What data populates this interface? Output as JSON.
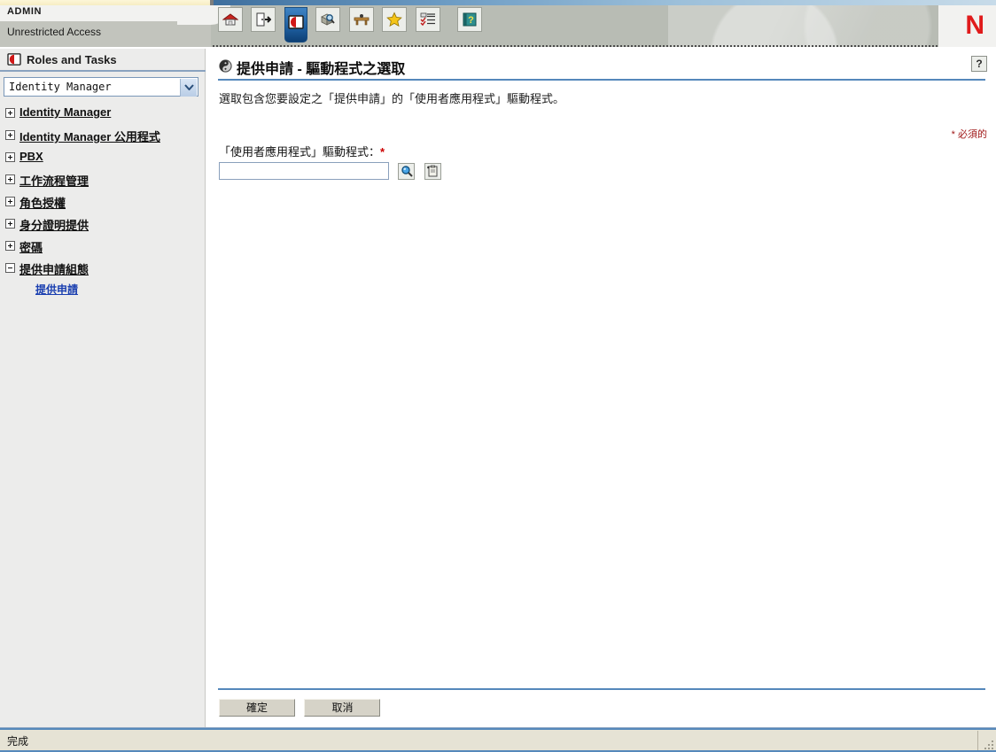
{
  "header": {
    "admin_label": "ADMIN",
    "access_label": "Unrestricted Access",
    "brand_logo": "N",
    "brand_color": "#e01b1b"
  },
  "toolbar": {
    "items": [
      {
        "name": "home-icon",
        "title": "Home"
      },
      {
        "name": "logout-icon",
        "title": "Exit"
      },
      {
        "name": "roles-and-tasks-icon",
        "title": "Roles and Tasks",
        "selected": true
      },
      {
        "name": "object-search-icon",
        "title": "View Objects"
      },
      {
        "name": "workbench-icon",
        "title": "Configure"
      },
      {
        "name": "favorites-star-icon",
        "title": "Favorites"
      },
      {
        "name": "task-list-icon",
        "title": "Task List"
      },
      {
        "name": "help-book-icon",
        "title": "Help"
      }
    ]
  },
  "sidebar": {
    "panel_title": "Roles and Tasks",
    "panel_icon": "roles-and-tasks-icon",
    "view_select": {
      "value": "Identity Manager",
      "options": [
        "Identity Manager"
      ]
    },
    "items": [
      {
        "label": "Identity Manager",
        "expanded": false
      },
      {
        "label": "Identity Manager 公用程式",
        "expanded": false
      },
      {
        "label": "PBX",
        "expanded": false
      },
      {
        "label": "工作流程管理",
        "expanded": false
      },
      {
        "label": "角色授權",
        "expanded": false
      },
      {
        "label": "身分證明提供",
        "expanded": false
      },
      {
        "label": "密碼",
        "expanded": false
      },
      {
        "label": "提供申請組態",
        "expanded": true,
        "children": [
          {
            "label": "提供申請",
            "selected": true
          }
        ]
      }
    ]
  },
  "content": {
    "help_button": "?",
    "title": "提供申請 - 驅動程式之選取",
    "title_icon": "provisioning-request-icon",
    "description": "選取包含您要設定之「提供申請」的「使用者應用程式」驅動程式。",
    "required_note": "* 必須的",
    "field": {
      "label": "「使用者應用程式」驅動程式：",
      "required_mark": "*",
      "value": "",
      "placeholder": "",
      "search_icon": "magnifier-icon",
      "object_selector_icon": "object-selector-icon"
    },
    "buttons": [
      {
        "label": "確定",
        "name": "ok-button"
      },
      {
        "label": "取消",
        "name": "cancel-button"
      }
    ]
  },
  "statusbar": {
    "text": "完成"
  }
}
